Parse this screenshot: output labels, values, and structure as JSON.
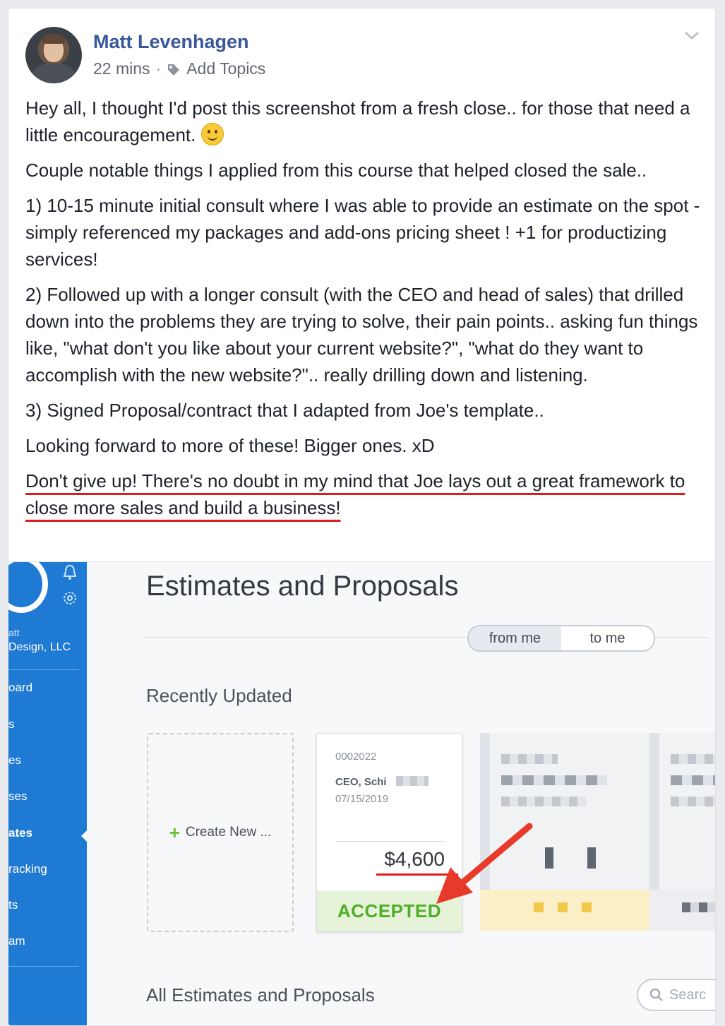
{
  "post": {
    "author": "Matt Levenhagen",
    "time": "22 mins",
    "separator": "·",
    "add_topics": "Add Topics",
    "paragraphs": {
      "p1": "Hey all, I thought I'd post this screenshot from a fresh close.. for those that need a little encouragement.",
      "p2": "Couple notable things I applied from this course that helped closed the sale..",
      "p3": "1) 10-15 minute initial consult where I was able to provide an estimate on the spot - simply referenced my packages and add-ons pricing sheet ! +1 for productizing services!",
      "p4": "2) Followed up with a longer consult (with the CEO and head of sales) that drilled down into the problems they are trying to solve, their pain points.. asking fun things like, \"what don't you like about your current website?\", \"what do they want to accomplish with the new website?\".. really drilling down and listening.",
      "p5": "3) Signed Proposal/contract that I adapted from Joe's template..",
      "p6": "Looking forward to more of these! Bigger ones. xD",
      "p7": "Don't give up! There's no doubt in my mind that Joe lays out a great framework to close more sales and build a business!"
    }
  },
  "screenshot": {
    "sidebar": {
      "company_line1": "att",
      "company_line2": "Design, LLC",
      "items": [
        "oard",
        "s",
        "es",
        "ses",
        "ates",
        "racking",
        "ts",
        "am"
      ]
    },
    "title": "Estimates and Proposals",
    "toggle": {
      "from_me": "from me",
      "to_me": "to me"
    },
    "recently_updated": "Recently Updated",
    "create_new": "Create New ...",
    "card": {
      "number": "0002022",
      "client": "CEO, Schi",
      "date": "07/15/2019",
      "amount": "$4,600",
      "status": "ACCEPTED"
    },
    "all_heading": "All Estimates and Proposals",
    "search_placeholder": "Searc",
    "colors": {
      "sidebar": "#1f7ad4",
      "accepted_text": "#4fae28",
      "accent_red": "#e01b1b"
    }
  }
}
